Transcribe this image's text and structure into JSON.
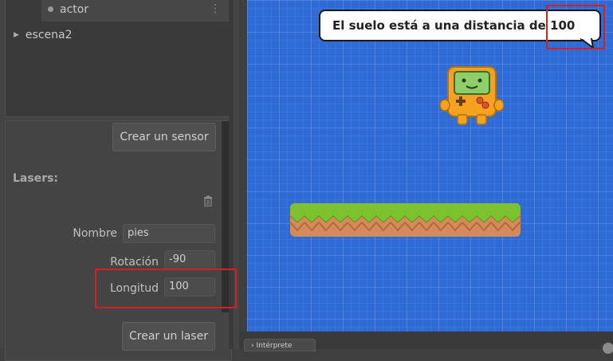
{
  "tree": {
    "items": [
      {
        "label": "actor"
      },
      {
        "label": "escena2"
      }
    ]
  },
  "props": {
    "create_sensor_button": "Crear un sensor",
    "lasers_title": "Lasers:",
    "fields": {
      "nombre": {
        "label": "Nombre",
        "value": "pies"
      },
      "rotacion": {
        "label": "Rotación",
        "value": "-90"
      },
      "longitud": {
        "label": "Longitud",
        "value": "100"
      }
    },
    "create_laser_button": "Crear un laser"
  },
  "canvas": {
    "bubble_text": "El suelo está a una distancia de 100",
    "colors": {
      "background": "#2e6bd6",
      "grass": "#7cc22e",
      "dirt": "#d48a5a"
    }
  },
  "bottom": {
    "interpreter_tab": "› Intérprete"
  },
  "colors": {
    "highlight": "#d32020"
  }
}
